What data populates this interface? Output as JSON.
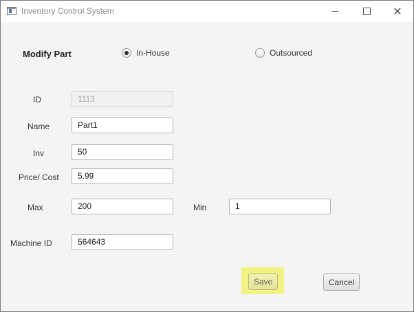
{
  "window": {
    "title": "Inventory Control System"
  },
  "form": {
    "heading": "Modify Part",
    "source_options": [
      {
        "label": "In-House",
        "selected": true
      },
      {
        "label": "Outsourced",
        "selected": false
      }
    ],
    "fields": {
      "id": {
        "label": "ID",
        "value": "1113",
        "disabled": true
      },
      "name": {
        "label": "Name",
        "value": "Part1"
      },
      "inv": {
        "label": "Inv",
        "value": "50"
      },
      "price": {
        "label": "Price/ Cost",
        "value": "5.99"
      },
      "max": {
        "label": "Max",
        "value": "200"
      },
      "min": {
        "label": "Min",
        "value": "1"
      },
      "machine_id": {
        "label": "Machine ID",
        "value": "564643"
      }
    },
    "buttons": {
      "save": "Save",
      "cancel": "Cancel"
    }
  },
  "colors": {
    "save_highlight": "#f3f384",
    "window_background": "#f4f4f4"
  }
}
